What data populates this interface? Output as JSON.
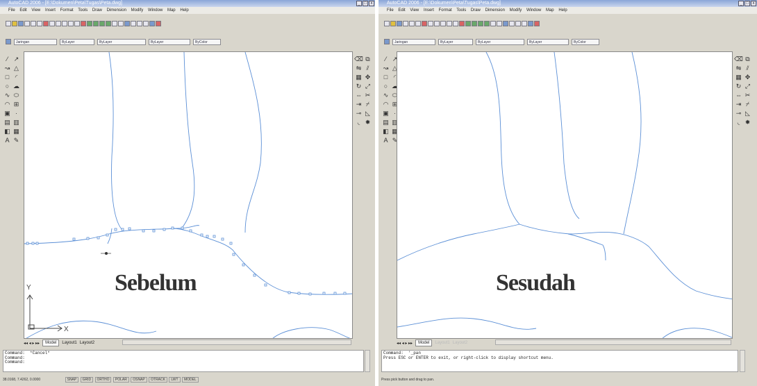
{
  "windows": {
    "before": {
      "title": "AutoCAD 2006 - [E:\\Dokumen\\Peta\\Tugas\\Peta.dwg]",
      "label": "Sebelum",
      "command_lines": [
        "Command:  *Cancel*",
        "Command:",
        "Command:"
      ],
      "coords": "38.0168, 7.4262, 0.0000",
      "status_buttons": [
        "SNAP",
        "GRID",
        "ORTHO",
        "POLAR",
        "OSNAP",
        "OTRACK",
        "LWT",
        "MODEL"
      ],
      "axis_x": "X",
      "axis_y": "Y",
      "layer": "Jaringan",
      "linetype": "ByLayer",
      "lineweight": "ByLayer",
      "color": "ByLayer",
      "plotstyle": "ByColor"
    },
    "after": {
      "title": "AutoCAD 2006 - [E:\\Dokumen\\Peta\\Tugas\\Peta.dwg]",
      "label": "Sesudah",
      "command_lines": [
        "Command:  '_pan",
        "Press ESC or ENTER to exit, or right-click to display shortcut menu."
      ],
      "status_text": "Press pick button and drag to pan.",
      "layer": "Jaringan",
      "linetype": "ByLayer",
      "lineweight": "ByLayer",
      "color": "ByLayer",
      "plotstyle": "ByColor"
    }
  },
  "menu": [
    "File",
    "Edit",
    "View",
    "Insert",
    "Format",
    "Tools",
    "Draw",
    "Dimension",
    "Modify",
    "Window",
    "Map",
    "Help"
  ],
  "tabs": [
    "Model",
    "Layout1",
    "Layout2"
  ],
  "win_buttons": [
    "_",
    "□",
    "x"
  ],
  "icons": {
    "left_draw_tools": [
      "line-icon",
      "xline-icon",
      "polyline-icon",
      "polygon-icon",
      "rectangle-icon",
      "arc-icon",
      "circle-icon",
      "spline-icon",
      "ellipse-icon",
      "insert-block-icon",
      "point-icon",
      "hatch-icon",
      "region-icon",
      "text-icon"
    ],
    "right_modify_tools": [
      "erase-icon",
      "copy-icon",
      "mirror-icon",
      "offset-icon",
      "array-icon",
      "move-icon",
      "rotate-icon",
      "scale-icon",
      "stretch-icon",
      "trim-icon",
      "extend-icon",
      "break-icon",
      "chamfer-icon",
      "fillet-icon",
      "explode-icon"
    ]
  },
  "colors": {
    "curve": "#5b8fd6",
    "canvas": "#ffffff",
    "chrome": "#d9d6cc"
  }
}
